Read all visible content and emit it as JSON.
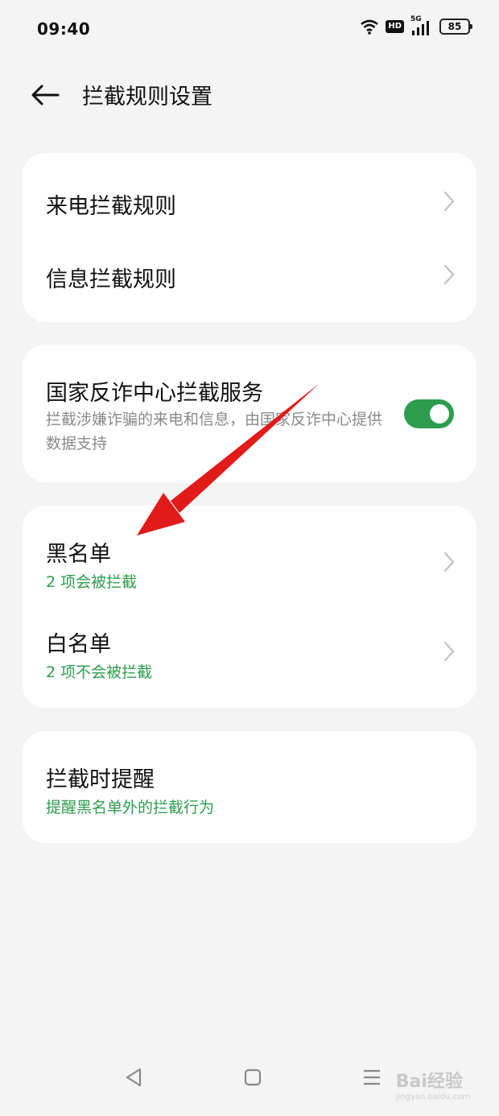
{
  "status_bar": {
    "time": "09:40",
    "hd": "HD",
    "network": "5G",
    "battery": "85"
  },
  "header": {
    "title": "拦截规则设置"
  },
  "card1": {
    "call_rules": "来电拦截规则",
    "message_rules": "信息拦截规则"
  },
  "card2": {
    "title": "国家反诈中心拦截服务",
    "description": "拦截涉嫌诈骗的来电和信息，由国家反诈中心提供数据支持",
    "enabled": true
  },
  "card3": {
    "blacklist_label": "黑名单",
    "blacklist_sub": "2 项会被拦截",
    "whitelist_label": "白名单",
    "whitelist_sub": "2 项不会被拦截"
  },
  "card4": {
    "title": "拦截时提醒",
    "sub": "提醒黑名单外的拦截行为"
  },
  "watermark": {
    "main": "Bai经验",
    "url": "jingyan.baidu.com"
  },
  "colors": {
    "accent": "#2d9c4e",
    "background": "#f4f4f4",
    "card": "#ffffff",
    "annotation_arrow": "#e11a1a"
  }
}
